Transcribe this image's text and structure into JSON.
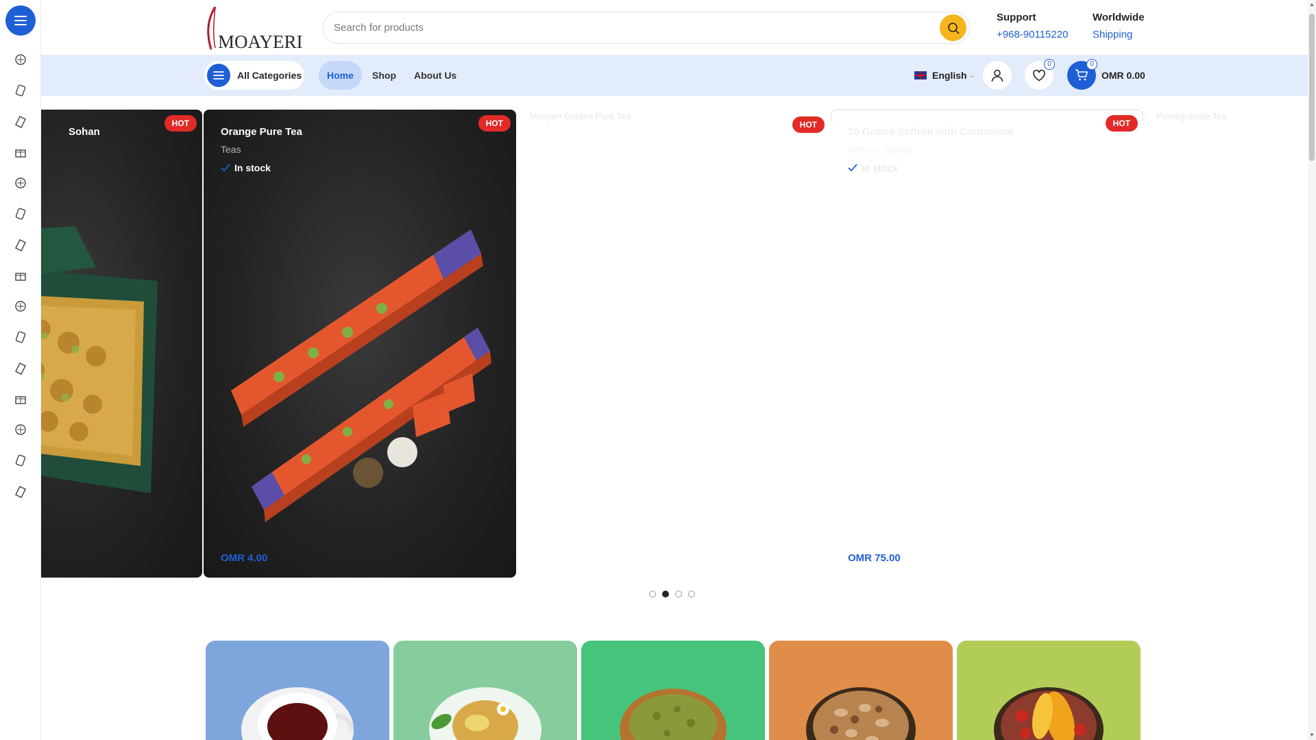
{
  "brand": {
    "logo_text": "MOAYERI"
  },
  "search": {
    "placeholder": "Search for products"
  },
  "header_info": {
    "support": {
      "title": "Support",
      "link": "+968-90115220"
    },
    "worldwide": {
      "title": "Worldwide",
      "link": "Shipping"
    }
  },
  "nav": {
    "all_categories": "All Categories",
    "items": [
      {
        "label": "Home",
        "active": true
      },
      {
        "label": "Shop",
        "active": false
      },
      {
        "label": "About Us",
        "active": false
      }
    ],
    "language": "English",
    "wishlist_count": "0",
    "cart_count": "0",
    "cart_total": "OMR 0.00"
  },
  "sidebar_icons": [
    "pastry-icon",
    "candy-icon",
    "tea-box-icon",
    "gift-icon",
    "dessert-icon",
    "dessert-alt-icon",
    "coffee-icon",
    "cake-icon",
    "nuts-icon",
    "saffron-icon",
    "herbs-icon",
    "bottle-icon",
    "spice-icon",
    "honey-icon",
    "dried-fruit-icon"
  ],
  "products": [
    {
      "title": "Sohan",
      "badge": "HOT"
    },
    {
      "title": "Orange Pure Tea",
      "category": "Teas",
      "stock": "In stock",
      "price": "OMR 4.00",
      "badge": "HOT"
    },
    {
      "image_alt": "Moayeri Golden Pure Tea",
      "badge": "HOT"
    },
    {
      "title": "30 Grams Saffron with Cardamom",
      "category": "Saffron, Spices",
      "stock": "In stock",
      "price": "OMR 75.00",
      "badge": "HOT"
    },
    {
      "image_alt": "Pomegranate Tea"
    }
  ],
  "carousel_dots": 4,
  "carousel_active_dot": 2,
  "colors": {
    "primary": "#1f5fd6",
    "accent": "#f6b51e",
    "hot": "#e02b27",
    "nav_bg": "#e3ecfb"
  },
  "category_tiles": [
    {
      "name": "black-tea",
      "color": "#7ea6dc"
    },
    {
      "name": "herbal-tea",
      "color": "#86cc9d"
    },
    {
      "name": "green-herbs",
      "color": "#46c47c"
    },
    {
      "name": "nuts",
      "color": "#e08d4a"
    },
    {
      "name": "dried-fruits",
      "color": "#b2cc58"
    }
  ]
}
